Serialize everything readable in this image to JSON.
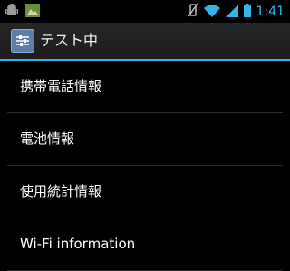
{
  "status_bar": {
    "time": "1:41",
    "left_icons": [
      "android-debug-icon",
      "notification-image-icon"
    ],
    "right_icons": [
      "vibrate-off-icon",
      "wifi-icon",
      "signal-icon",
      "battery-icon"
    ],
    "clock_color": "#33b5e5"
  },
  "action_bar": {
    "title": "テスト中",
    "icon": "settings-sliders-icon",
    "accent_color": "#33b5e5"
  },
  "list": {
    "items": [
      {
        "label": "携帯電話情報"
      },
      {
        "label": "電池情報"
      },
      {
        "label": "使用統計情報"
      },
      {
        "label": "Wi-Fi information"
      }
    ]
  }
}
